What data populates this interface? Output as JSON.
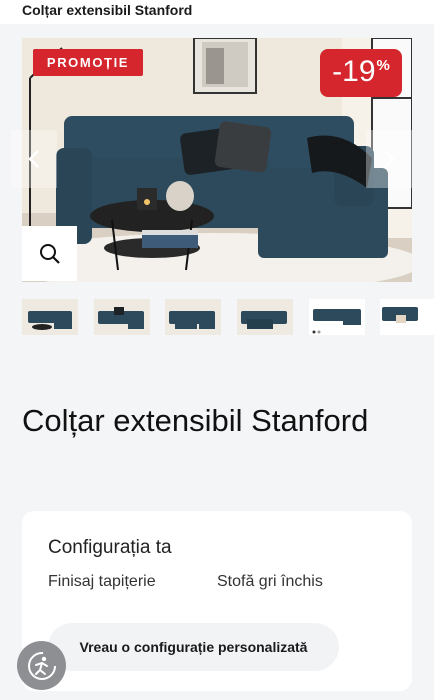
{
  "header": {
    "title": "Colțar extensibil Stanford"
  },
  "gallery": {
    "promo_badge": "PROMOȚIE",
    "discount": {
      "value": "-19",
      "unit": "%"
    },
    "icons": {
      "prev": "chevron-left-icon",
      "next": "chevron-right-icon",
      "zoom": "search-icon"
    }
  },
  "thumbnails": [
    {
      "name": "thumbnail-1"
    },
    {
      "name": "thumbnail-2"
    },
    {
      "name": "thumbnail-3"
    },
    {
      "name": "thumbnail-4"
    },
    {
      "name": "thumbnail-5"
    },
    {
      "name": "thumbnail-6"
    }
  ],
  "product": {
    "title": "Colțar extensibil Stanford"
  },
  "configuration": {
    "heading": "Configurația ta",
    "row_label": "Finisaj tapițerie",
    "row_value": "Stofă gri închis",
    "custom_button": "Vreau o configurație personalizată"
  },
  "colors": {
    "accent": "#d4262c",
    "sofa": "#2c4a5c",
    "card": "#ffffff",
    "background": "#f4f5f7"
  }
}
